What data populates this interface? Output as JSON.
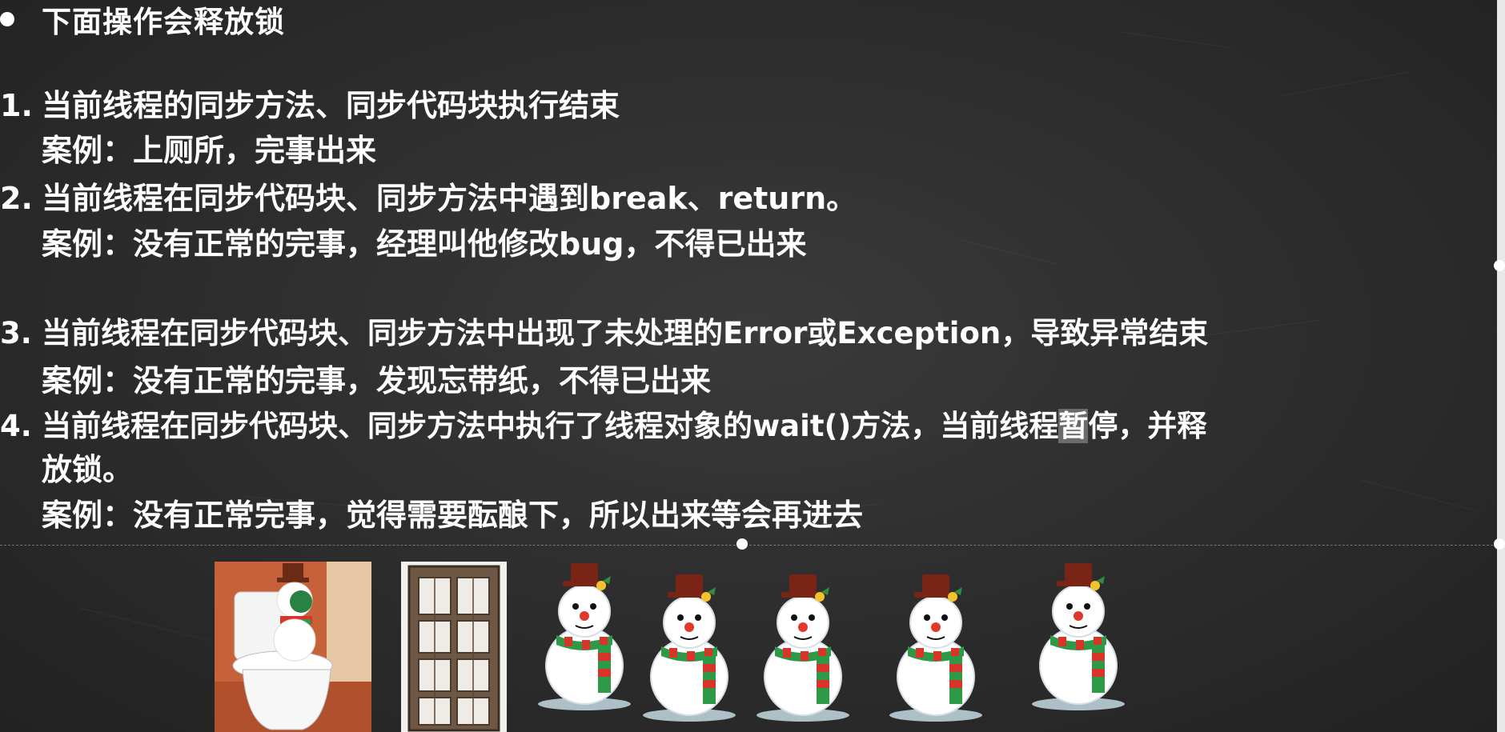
{
  "slide": {
    "title": "下面操作会释放锁",
    "items": [
      {
        "number": "1.",
        "main": "当前线程的同步方法、同步代码块执行结束",
        "example": "案例：上厕所，完事出来"
      },
      {
        "number": "2.",
        "main": "当前线程在同步代码块、同步方法中遇到break、return。",
        "example": "案例：没有正常的完事，经理叫他修改bug，不得已出来"
      },
      {
        "number": "3.",
        "main": "当前线程在同步代码块、同步方法中出现了未处理的Error或Exception，导致异常结束",
        "example": "案例：没有正常的完事，发现忘带纸，不得已出来"
      },
      {
        "number": "4.",
        "main_before": "当前线程在同步代码块、同步方法中执行了线程对象的wait()方法，当前线程",
        "main_highlight": "暂",
        "main_after": "停，并释",
        "main_cont": "放锁。",
        "example": "案例：没有正常完事，觉得需要酝酿下，所以出来等会再进去"
      }
    ]
  },
  "images": {
    "toilet": "toilet-with-snowman-image",
    "door": "wooden-door-image",
    "snowman_count": 5
  },
  "colors": {
    "background": "#2c2c2c",
    "text": "#ffffff",
    "highlight": "#6b6b6b"
  }
}
